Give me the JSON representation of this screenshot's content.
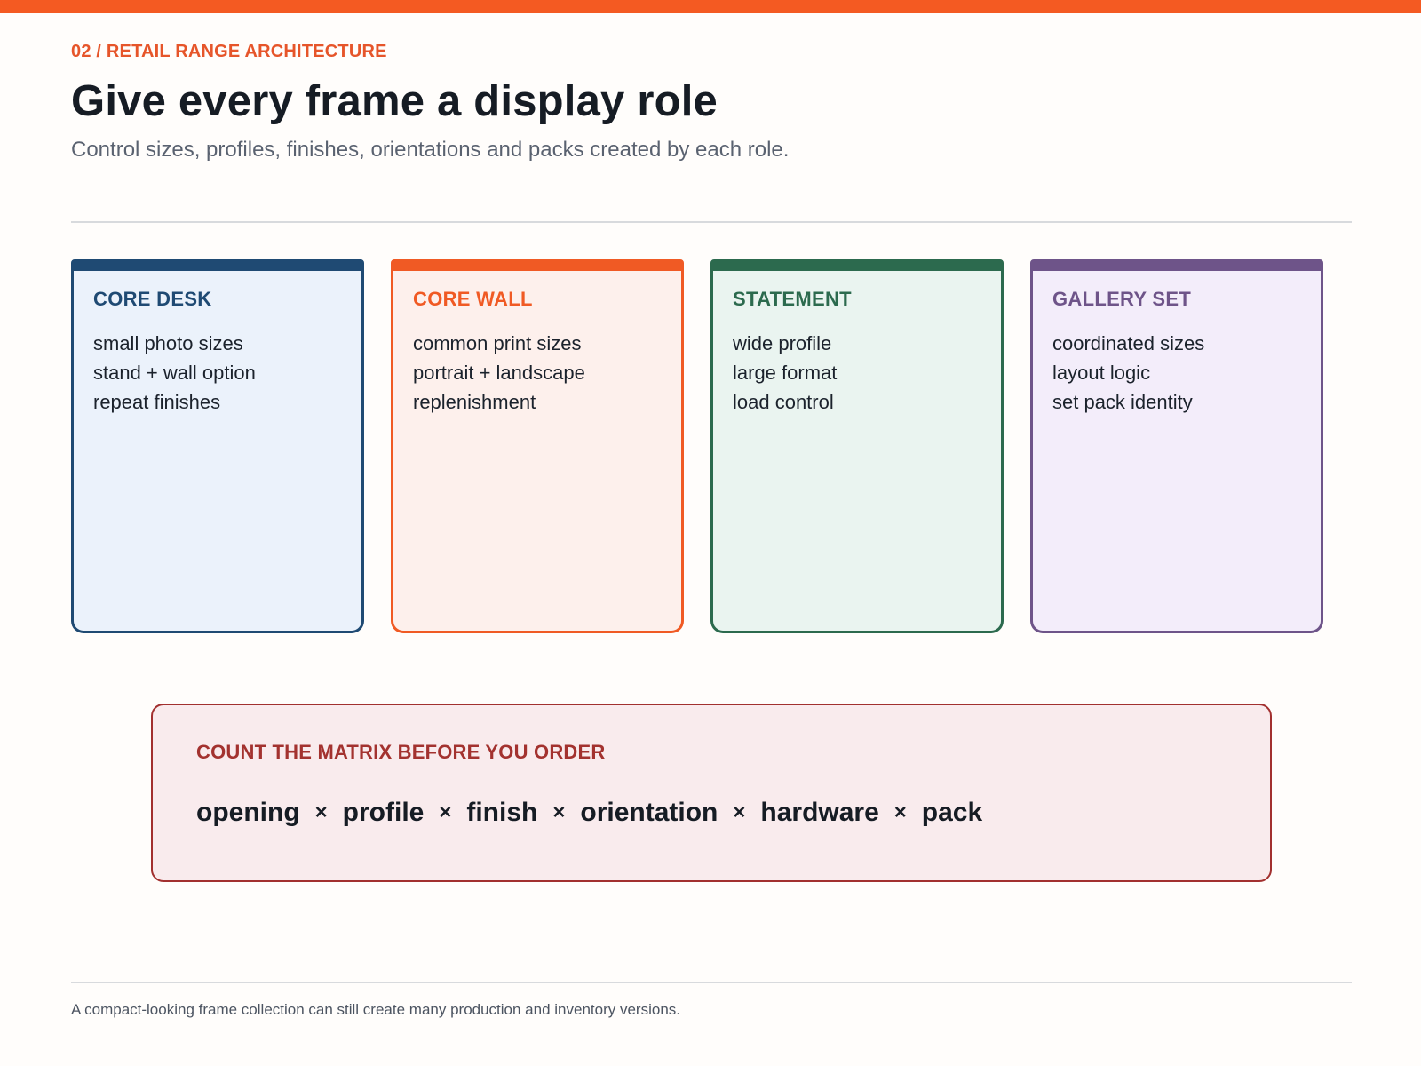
{
  "header": {
    "eyebrow": "02 / RETAIL RANGE ARCHITECTURE",
    "title": "Give every frame a display role",
    "subtitle": "Control sizes, profiles, finishes, orientations and packs created by each role."
  },
  "cards": [
    {
      "title": "CORE DESK",
      "items": [
        "small photo sizes",
        "stand + wall option",
        "repeat finishes"
      ],
      "accent": "#1f4a73",
      "background": "#ebf2fb"
    },
    {
      "title": "CORE WALL",
      "items": [
        "common print sizes",
        "portrait + landscape",
        "replenishment"
      ],
      "accent": "#f05a24",
      "background": "#fdf0ec"
    },
    {
      "title": "STATEMENT",
      "items": [
        "wide profile",
        "large format",
        "load control"
      ],
      "accent": "#2c6a4e",
      "background": "#eaf4f0"
    },
    {
      "title": "GALLERY SET",
      "items": [
        "coordinated sizes",
        "layout logic",
        "set pack identity"
      ],
      "accent": "#6e5489",
      "background": "#f3edfa"
    }
  ],
  "matrix": {
    "title": "COUNT THE MATRIX BEFORE YOU ORDER",
    "factors": [
      "opening",
      "profile",
      "finish",
      "orientation",
      "hardware",
      "pack"
    ],
    "separator": "×",
    "accent": "#a2302f",
    "background": "#f9ebed"
  },
  "footer": {
    "note": "A compact-looking frame collection can still create many production and inventory versions."
  },
  "colors": {
    "brand_orange": "#f45a22",
    "eyebrow": "#e6552a",
    "title": "#161c24",
    "subtitle": "#5a6270"
  }
}
